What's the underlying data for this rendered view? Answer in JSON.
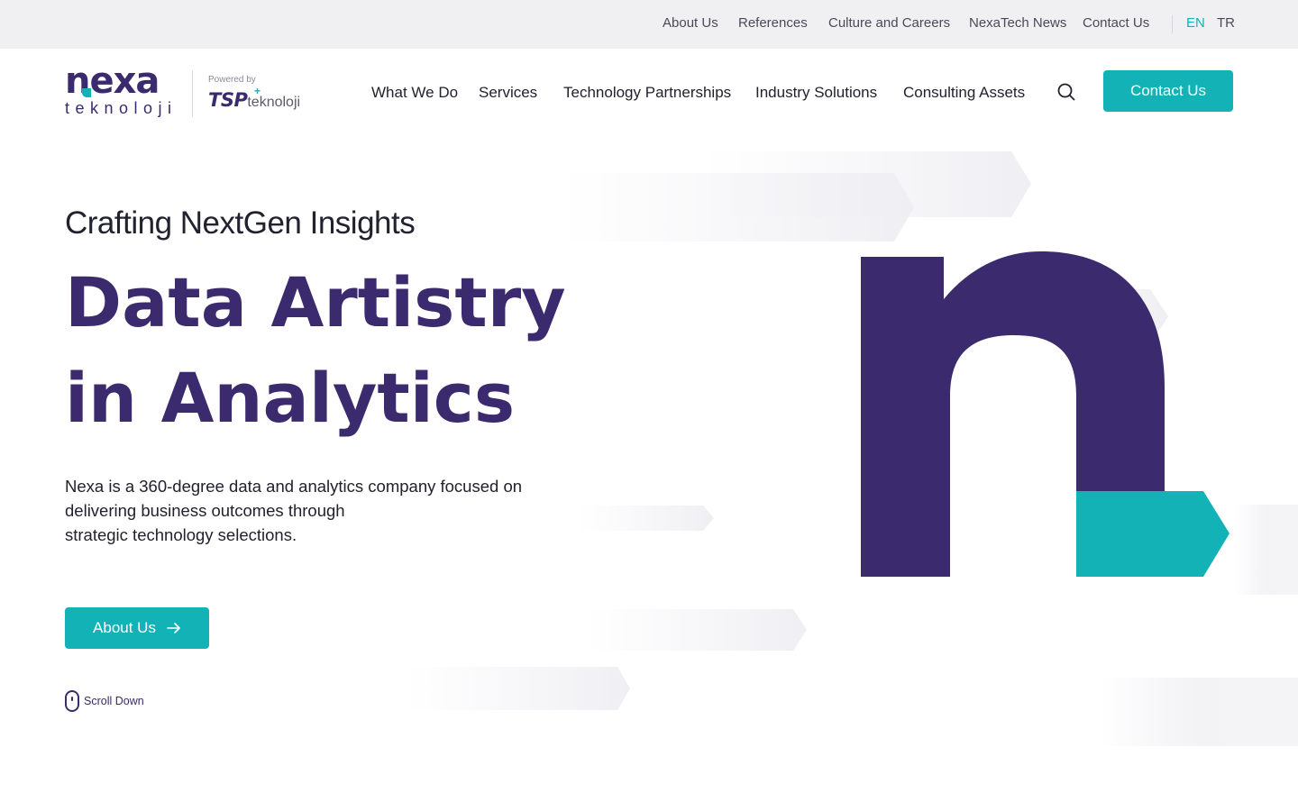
{
  "topbar": {
    "links": [
      "About Us",
      "References",
      "Culture and Careers",
      "NexaTech News",
      "Contact Us"
    ],
    "lang_active": "EN",
    "lang_other": "TR"
  },
  "logo": {
    "word": "nexa",
    "sub": "teknoloji",
    "powered_by": "Powered by",
    "partner_main": "TSP",
    "partner_sub": "teknoloji",
    "partner_mark": "+"
  },
  "nav": {
    "items": [
      "What We Do",
      "Services",
      "Technology Partnerships",
      "Industry Solutions",
      "Consulting Assets"
    ],
    "search_icon": "search-icon",
    "cta_label": "Contact Us"
  },
  "hero": {
    "eyebrow": "Crafting NextGen Insights",
    "title_line1": "Data Artistry",
    "title_line2": "in Analytics",
    "desc_lines": [
      "Nexa is a 360-degree data and analytics company focused on",
      "delivering business outcomes through",
      "strategic technology selections."
    ],
    "button_label": "About Us",
    "button_icon": "arrow-right-icon",
    "scroll_label": "Scroll Down"
  },
  "colors": {
    "brand_purple": "#3b2a6e",
    "brand_teal": "#12b2b7",
    "topbar_bg": "#f0f0f3"
  }
}
